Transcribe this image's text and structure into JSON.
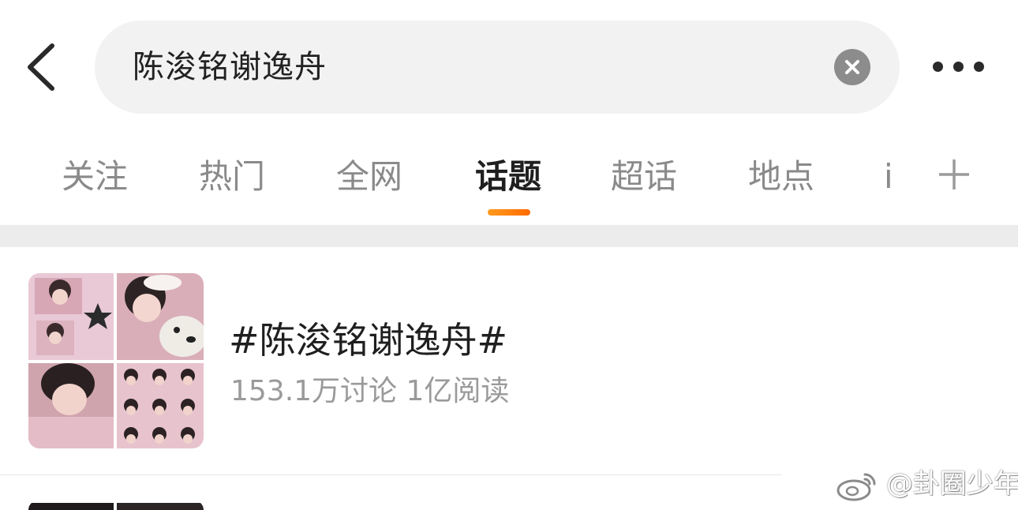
{
  "search": {
    "query": "陈浚铭谢逸舟"
  },
  "tabs": [
    {
      "label": "关注"
    },
    {
      "label": "热门"
    },
    {
      "label": "全网"
    },
    {
      "label": "话题",
      "active": true
    },
    {
      "label": "超话"
    },
    {
      "label": "地点"
    }
  ],
  "tab_partial_label": "i",
  "result": {
    "title": "#陈浚铭谢逸舟#",
    "discussions": "153.1万讨论",
    "reads": "1亿阅读"
  },
  "watermark": "@卦圈少年",
  "colors": {
    "accent": "#ff7a00",
    "search_bg": "#f2f2f2",
    "inactive_tab": "#8a8a8a",
    "divider_band": "#ececec"
  },
  "icons": [
    "back-arrow-icon",
    "clear-icon",
    "more-icon",
    "plus-icon",
    "weibo-logo-icon"
  ]
}
